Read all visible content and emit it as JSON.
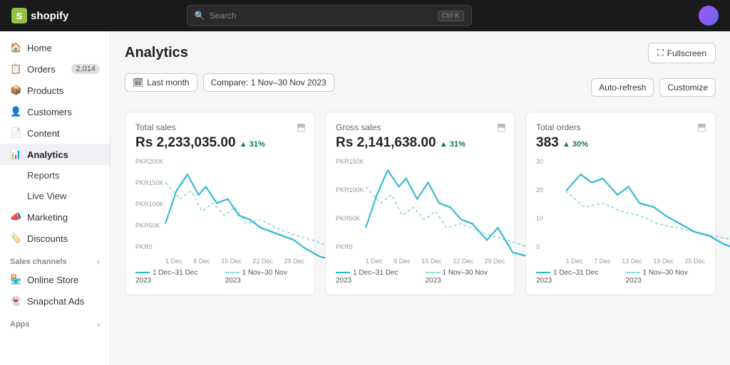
{
  "topnav": {
    "logo": "shopify",
    "search_placeholder": "Search",
    "search_shortcut": "Ctrl K"
  },
  "sidebar": {
    "items": [
      {
        "id": "home",
        "label": "Home",
        "icon": "🏠",
        "badge": null,
        "active": false
      },
      {
        "id": "orders",
        "label": "Orders",
        "icon": "📋",
        "badge": "2,014",
        "active": false
      },
      {
        "id": "products",
        "label": "Products",
        "icon": "📦",
        "badge": null,
        "active": false
      },
      {
        "id": "customers",
        "label": "Customers",
        "icon": "👤",
        "badge": null,
        "active": false
      },
      {
        "id": "content",
        "label": "Content",
        "icon": "📄",
        "badge": null,
        "active": false
      },
      {
        "id": "analytics",
        "label": "Analytics",
        "icon": "📊",
        "badge": null,
        "active": true
      },
      {
        "id": "reports",
        "label": "Reports",
        "icon": null,
        "badge": null,
        "active": false,
        "sub": true
      },
      {
        "id": "liveview",
        "label": "Live View",
        "icon": null,
        "badge": null,
        "active": false,
        "sub": true
      },
      {
        "id": "marketing",
        "label": "Marketing",
        "icon": "📣",
        "badge": null,
        "active": false
      },
      {
        "id": "discounts",
        "label": "Discounts",
        "icon": "🏷️",
        "badge": null,
        "active": false
      }
    ],
    "sections": [
      {
        "label": "Sales channels"
      },
      {
        "label": "Online Store"
      },
      {
        "label": "Snapchat Ads"
      }
    ],
    "apps_label": "Apps"
  },
  "page": {
    "title": "Analytics",
    "fullscreen_label": "Fullscreen",
    "filter_date": "Last month",
    "filter_compare": "Compare: 1 Nov–30 Nov 2023",
    "auto_refresh_label": "Auto-refresh",
    "customize_label": "Customize"
  },
  "cards": [
    {
      "title": "Total sales",
      "value": "Rs 2,233,035.00",
      "change": "31%",
      "change_dir": "up",
      "yaxis": [
        "PKR200K",
        "PKR150K",
        "PKR100K",
        "PKR50K",
        "PKR0"
      ],
      "xaxis": [
        "1 Dec",
        "8 Dec",
        "15 Dec",
        "22 Dec",
        "29 Dec"
      ],
      "legend_current": "1 Dec–31 Dec 2023",
      "legend_compare": "1 Nov–30 Nov 2023"
    },
    {
      "title": "Gross sales",
      "value": "Rs 2,141,638.00",
      "change": "31%",
      "change_dir": "up",
      "yaxis": [
        "PKR150K",
        "PKR100K",
        "PKR50K",
        "PKR0"
      ],
      "xaxis": [
        "1 Dec",
        "8 Dec",
        "15 Dec",
        "22 Dec",
        "29 Dec"
      ],
      "legend_current": "1 Dec–31 Dec 2023",
      "legend_compare": "1 Nov–30 Nov 2023"
    },
    {
      "title": "Total orders",
      "value": "383",
      "change": "30%",
      "change_dir": "up",
      "yaxis": [
        "30",
        "20",
        "10",
        "0"
      ],
      "xaxis": [
        "1 Dec",
        "7 Dec",
        "13 Dec",
        "19 Dec",
        "25 Dec"
      ],
      "legend_current": "1 Dec–31 Dec 2023",
      "legend_compare": "1 Nov–30 Nov 2023"
    }
  ]
}
